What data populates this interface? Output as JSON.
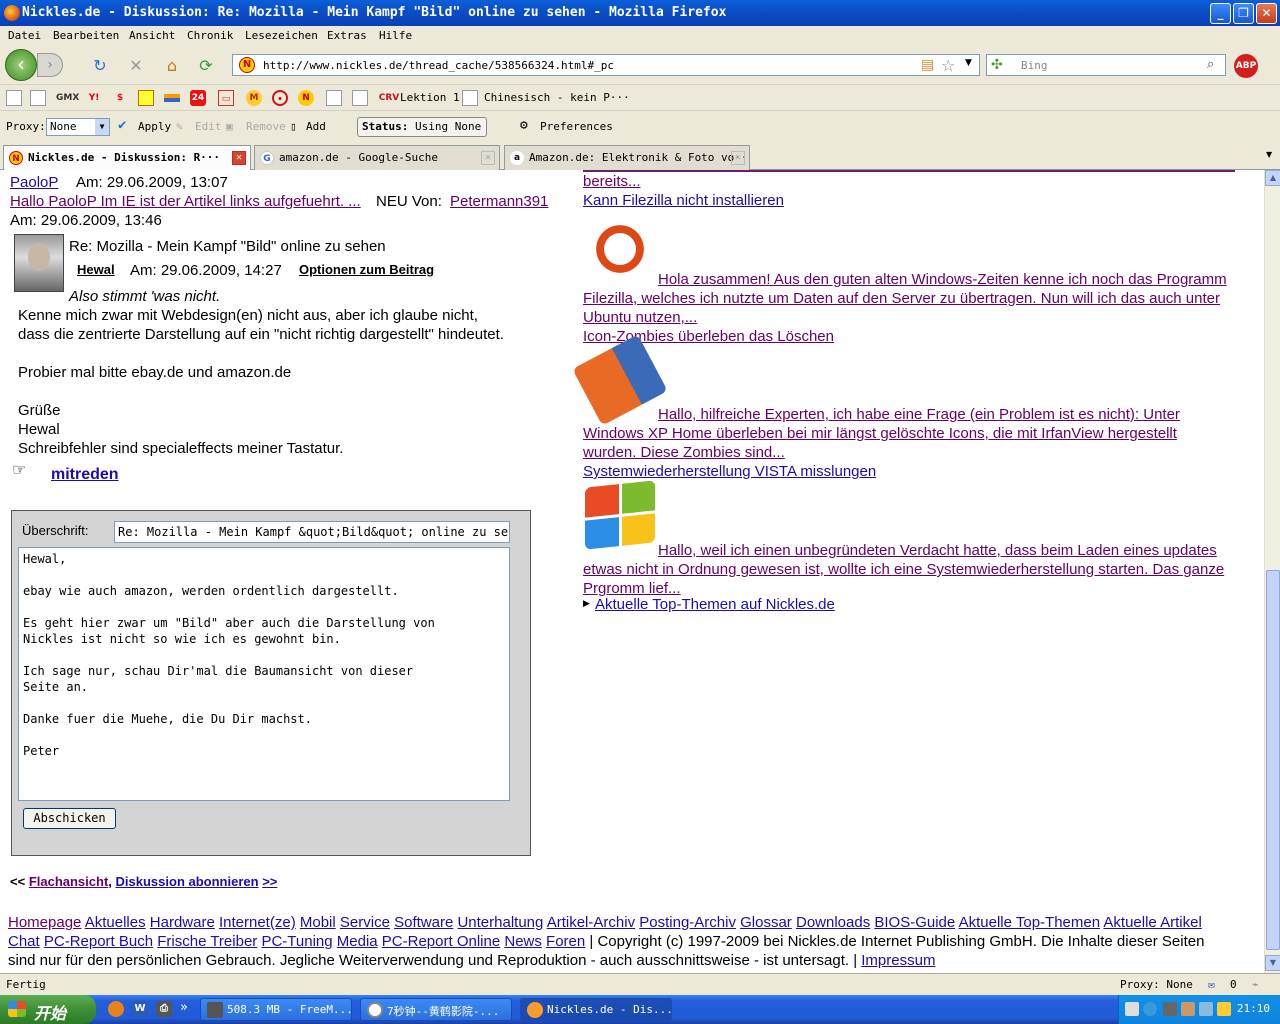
{
  "window": {
    "title": "Nickles.de - Diskussion: Re: Mozilla - Mein Kampf \"Bild\" online zu sehen - Mozilla Firefox",
    "minimize": "_",
    "maximize": "❐",
    "close": "✕"
  },
  "menu": [
    "Datei",
    "Bearbeiten",
    "Ansicht",
    "Chronik",
    "Lesezeichen",
    "Extras",
    "Hilfe"
  ],
  "nav": {
    "url": "http://www.nickles.de/thread_cache/538566324.html#_pc",
    "search_placeholder": "Bing",
    "abp": "ABP"
  },
  "bookmarks": {
    "gmx": "GMX",
    "y": "Y!",
    "n24": "24",
    "crv": "CRV",
    "lektion": "Lektion 1",
    "chinesisch": "Chinesisch - kein P···"
  },
  "proxybar": {
    "proxy_label": "Proxy:",
    "proxy_value": "None",
    "apply": "Apply",
    "edit": "Edit",
    "remove": "Remove",
    "add": "Add",
    "status_label": "Status:",
    "status_value": "Using None",
    "preferences": "Preferences"
  },
  "tabs": [
    {
      "label": "Nickles.de - Diskussion: R···",
      "icon": "N"
    },
    {
      "label": "amazon.de - Google-Suche",
      "icon": "G"
    },
    {
      "label": "Amazon.de: Elektronik & Foto vo···",
      "icon": "a"
    }
  ],
  "thread": {
    "prev_author": "PaoloP",
    "prev_date": "Am: 29.06.2009, 13:07",
    "reply_link": "Hallo PaoloP Im IE ist der Artikel links aufgefuehrt. ...",
    "reply_new": "NEU Von:",
    "reply_author": "Petermann391",
    "reply_date": "Am: 29.06.2009, 13:46",
    "post_title": "Re: Mozilla - Mein Kampf \"Bild\" online zu sehen",
    "post_author": "Hewal",
    "post_date": "Am: 29.06.2009, 14:27",
    "post_options": "Optionen zum Beitrag",
    "post_lines": [
      "Also stimmt 'was nicht.",
      "Kenne mich zwar mit Webdesign(en) nicht aus, aber ich glaube nicht,",
      "dass die zentrierte Darstellung auf ein \"nicht richtig dargestellt\" hindeutet.",
      "Probier mal bitte ebay.de und amazon.de",
      "Grüße",
      "Hewal",
      "Schreibfehler sind specialeffects meiner Tastatur."
    ],
    "mitreden": "mitreden"
  },
  "form": {
    "subject_label": "Überschrift:",
    "subject_value": "Re: Mozilla  -  Mein Kampf &quot;Bild&quot; online zu sehen",
    "message": "Hewal,\n\nebay wie auch amazon, werden ordentlich dargestellt.\n\nEs geht hier zwar um \"Bild\" aber auch die Darstellung von\nNickles ist nicht so wie ich es gewohnt bin.\n\nIch sage nur, schau Dir'mal die Baumansicht von dieser\nSeite an.\n\nDanke fuer die Muehe, die Du Dir machst.\n\nPeter",
    "submit": "Abschicken"
  },
  "bottom_nav": {
    "prev": "<<",
    "flat": "Flachansicht",
    "comma": ",",
    "subscribe": "Diskussion abonnieren",
    "next": ">>"
  },
  "sidebar": {
    "top_link": "bereits...",
    "items": [
      {
        "title": "Kann Filezilla nicht installieren",
        "text": "Hola zusammen! Aus den guten alten Windows-Zeiten kenne ich noch das Programm",
        "text2": "Filezilla, welches ich nutzte um Daten auf den Server zu übertragen. Nun will ich das auch unter",
        "text3": "Ubuntu nutzen,..."
      },
      {
        "title": "Icon-Zombies überleben das Löschen",
        "text": "Hallo, hilfreiche Experten, ich habe eine Frage (ein Problem ist es nicht): Unter",
        "text2": "Windows XP Home überleben bei mir längst gelöschte Icons, die mit IrfanView hergestellt",
        "text3": "wurden. Diese Zombies sind..."
      },
      {
        "title": "Systemwiederherstellung VISTA misslungen",
        "text": "Hallo, weil ich einen unbegründeten Verdacht hatte, dass beim Laden eines updates",
        "text2": "etwas nicht in Ordnung gewesen ist, wollte ich eine Systemwiederherstellung starten. Das ganze",
        "text3": "Prgromm lief..."
      }
    ],
    "top_themen": "Aktuelle Top-Themen auf Nickles.de"
  },
  "footer": {
    "row1": [
      "Homepage",
      "Aktuelles",
      "Hardware",
      "Internet(ze)",
      "Mobil",
      "Service",
      "Software",
      "Unterhaltung",
      "Artikel-Archiv",
      "Posting-Archiv",
      "Glossar",
      "Downloads",
      "BIOS-Guide",
      "Aktuelle Top-Themen",
      "Aktuelle Artikel"
    ],
    "row2": [
      "Chat",
      "PC-Report Buch",
      "Frische Treiber",
      "PC-Tuning",
      "Media",
      "PC-Report Online",
      "News",
      "Foren"
    ],
    "copyright": "| Copyright (c) 1997-2009 bei Nickles.de Internet Publishing GmbH. Die Inhalte dieser Seiten",
    "copyright2": "sind nur für den persönlichen Gebrauch. Jegliche Weiterverwendung und Reproduktion - auch ausschnittsweise - ist untersagt. |",
    "impressum": "Impressum"
  },
  "statusbar": {
    "status": "Fertig",
    "proxy": "Proxy: None",
    "mail_count": "0"
  },
  "taskbar": {
    "start": "开始",
    "tasks": [
      "508.3 MB - FreeM...",
      "7秒钟--黄鹤影院-...",
      "Nickles.de - Dis..."
    ],
    "more": "»",
    "clock": "21:10"
  }
}
